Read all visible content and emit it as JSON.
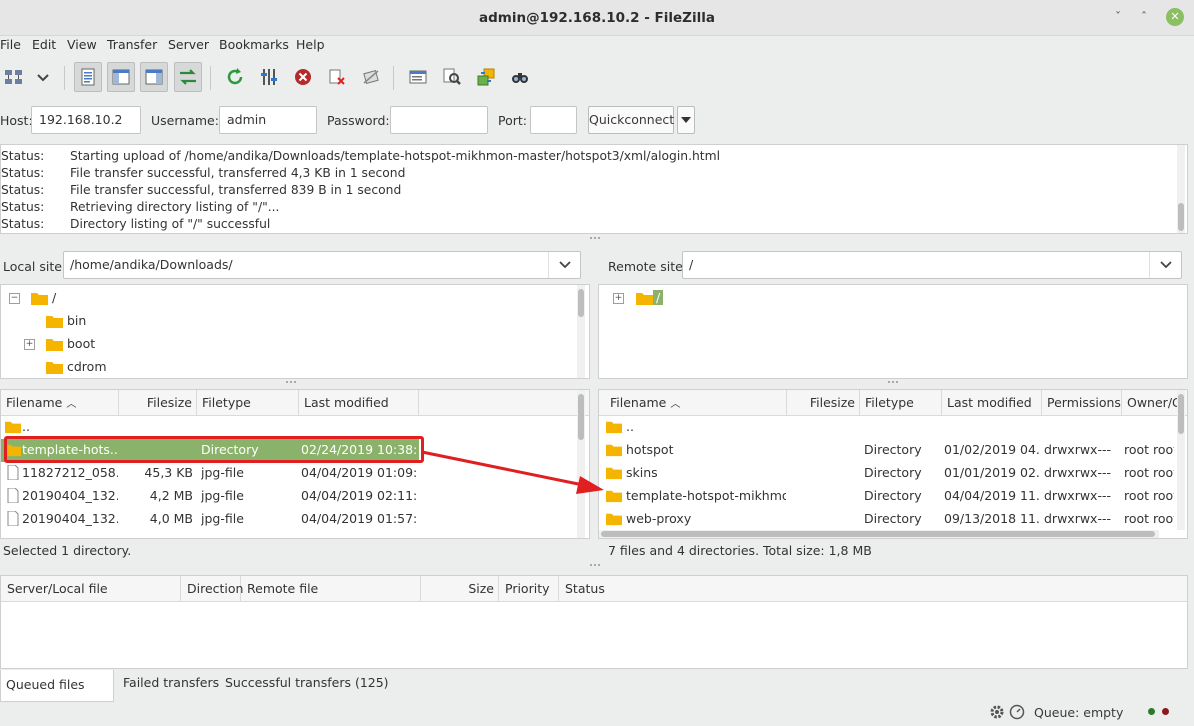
{
  "window": {
    "title": "admin@192.168.10.2 - FileZilla",
    "controls": {
      "minimize": "ˇ",
      "maximize": "ˆ",
      "close": "✕"
    }
  },
  "menu": [
    "File",
    "Edit",
    "View",
    "Transfer",
    "Server",
    "Bookmarks",
    "Help"
  ],
  "toolbar": {
    "icons": [
      "site-manager-icon",
      "dropdown-icon",
      "toggle-log-icon",
      "toggle-local-tree-icon",
      "toggle-remote-tree-icon",
      "toggle-queue-icon",
      "refresh-icon",
      "process-queue-icon",
      "cancel-icon",
      "disconnect-icon",
      "reconnect-icon",
      "filter-icon",
      "compare-icon",
      "sync-browse-icon",
      "search-icon"
    ]
  },
  "quickconnect": {
    "host_label": "Host:",
    "host_value": "192.168.10.2",
    "username_label": "Username:",
    "username_value": "admin",
    "password_label": "Password:",
    "password_value": "",
    "port_label": "Port:",
    "port_value": "",
    "button_label": "Quickconnect"
  },
  "log": [
    {
      "key": "Status:",
      "msg": "Starting upload of /home/andika/Downloads/template-hotspot-mikhmon-master/hotspot3/xml/alogin.html"
    },
    {
      "key": "Status:",
      "msg": "File transfer successful, transferred 4,3 KB in 1 second"
    },
    {
      "key": "Status:",
      "msg": "File transfer successful, transferred 839 B in 1 second"
    },
    {
      "key": "Status:",
      "msg": "Retrieving directory listing of \"/\"..."
    },
    {
      "key": "Status:",
      "msg": "Directory listing of \"/\" successful"
    }
  ],
  "local": {
    "site_label": "Local site:",
    "site_path": "/home/andika/Downloads/",
    "tree": [
      {
        "expander": "−",
        "label": "/"
      },
      {
        "expander": "",
        "label": "bin"
      },
      {
        "expander": "+",
        "label": "boot"
      },
      {
        "expander": "",
        "label": "cdrom"
      }
    ],
    "columns": [
      "Filename",
      "Filesize",
      "Filetype",
      "Last modified"
    ],
    "files": [
      {
        "name": "..",
        "size": "",
        "type": "",
        "modified": "",
        "folder": true
      },
      {
        "name": "template-hots...",
        "size": "",
        "type": "Directory",
        "modified": "02/24/2019 10:38:...",
        "folder": true
      },
      {
        "name": "11827212_058...",
        "size": "45,3 KB",
        "type": "jpg-file",
        "modified": "04/04/2019 01:09:...",
        "folder": false
      },
      {
        "name": "20190404_132...",
        "size": "4,2 MB",
        "type": "jpg-file",
        "modified": "04/04/2019 02:11:...",
        "folder": false
      },
      {
        "name": "20190404_132...",
        "size": "4,0 MB",
        "type": "jpg-file",
        "modified": "04/04/2019 01:57:...",
        "folder": false
      }
    ],
    "status": "Selected 1 directory."
  },
  "remote": {
    "site_label": "Remote site:",
    "site_path": "/",
    "tree": [
      {
        "expander": "+",
        "label": "/"
      }
    ],
    "columns": [
      "Filename",
      "Filesize",
      "Filetype",
      "Last modified",
      "Permissions",
      "Owner/G"
    ],
    "files": [
      {
        "name": "..",
        "size": "",
        "type": "",
        "modified": "",
        "perms": "",
        "owner": ""
      },
      {
        "name": "hotspot",
        "size": "",
        "type": "Directory",
        "modified": "01/02/2019 04...",
        "perms": "drwxrwx---",
        "owner": "root root"
      },
      {
        "name": "skins",
        "size": "",
        "type": "Directory",
        "modified": "01/01/2019 02...",
        "perms": "drwxrwx---",
        "owner": "root root"
      },
      {
        "name": "template-hotspot-mikhmo...",
        "size": "",
        "type": "Directory",
        "modified": "04/04/2019 11...",
        "perms": "drwxrwx---",
        "owner": "root root"
      },
      {
        "name": "web-proxy",
        "size": "",
        "type": "Directory",
        "modified": "09/13/2018 11...",
        "perms": "drwxrwx---",
        "owner": "root root"
      }
    ],
    "status": "7 files and 4 directories. Total size: 1,8 MB"
  },
  "queue": {
    "columns": [
      "Server/Local file",
      "Direction",
      "Remote file",
      "Size",
      "Priority",
      "Status"
    ],
    "tabs": [
      "Queued files",
      "Failed transfers",
      "Successful transfers (125)"
    ]
  },
  "statusbar": {
    "queue": "Queue: empty"
  },
  "colors": {
    "selection": "#8bb26a",
    "annotation": "#e02020",
    "folder": "#f5b400"
  }
}
